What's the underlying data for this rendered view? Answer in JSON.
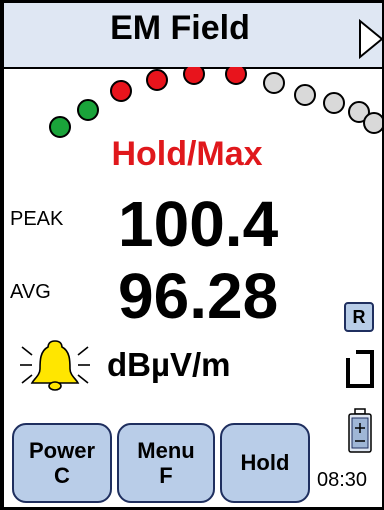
{
  "app": {
    "title": "EM Field"
  },
  "indicator": {
    "leds": [
      "green",
      "green",
      "red",
      "red",
      "red",
      "red",
      "off",
      "off",
      "off",
      "off",
      "off"
    ],
    "colors": {
      "green": "#1aa33a",
      "red": "#e8141c",
      "off": "#d9d9d9"
    }
  },
  "mode": "Hold/Max",
  "peak": {
    "label": "PEAK",
    "value": "100.4"
  },
  "avg": {
    "label": "AVG",
    "value": "96.28"
  },
  "unit": "dBµV/m",
  "side": {
    "r_label": "R"
  },
  "buttons": {
    "power": {
      "line1": "Power",
      "line2": "C"
    },
    "menu": {
      "line1": "Menu",
      "line2": "F"
    },
    "hold": {
      "label": "Hold"
    }
  },
  "time": "08:30",
  "icons": {
    "alarm": "bell-alarm-icon",
    "next": "play-triangle-icon",
    "storage": "sd-card-icon",
    "battery": "battery-icon"
  }
}
